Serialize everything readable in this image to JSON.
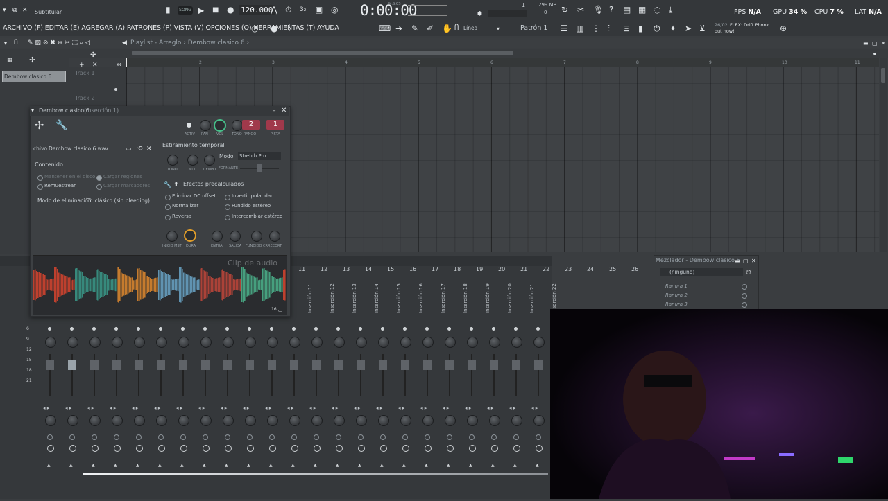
{
  "topbar": {
    "subtitle": "Subtitular",
    "song_label": "SONG",
    "tempo": "120.000",
    "time": "0:00:00",
    "time_unit": "M:S:CS",
    "memory": "299 MB",
    "cpu_count": "1",
    "voices": "0",
    "fps_label": "FPS",
    "fps_value": "N/A",
    "gpu_label": "GPU",
    "gpu_value": "34 %",
    "cpu_label": "CPU",
    "cpu_value": "7 %",
    "lat_label": "LAT",
    "lat_value": "N/A"
  },
  "menu": {
    "text": "ARCHIVO (F) EDITAR (E) AGREGAR (A) PATRONES (P) VISTA (V) OPCIONES (O) HERRAMIENTAS (T) AYUDA",
    "line_mode": "Línea",
    "pattern": "Patrón 1",
    "news_date": "26/02",
    "news_text": "FLEX: Drift Phonk",
    "news_sub": "out now!"
  },
  "playlist": {
    "title": "Playlist - Arreglo › Dembow clasico 6 ›",
    "ruler_marks": [
      "2",
      "3",
      "4",
      "5",
      "6",
      "7",
      "8",
      "9",
      "10",
      "11"
    ],
    "tracks": [
      "Track 1",
      "Track 2"
    ],
    "clip_label": "Dembow clasico 6"
  },
  "channel": {
    "title": "Dembow clasico 6",
    "subtitle": "(Inserción 1)",
    "knob_labels": [
      "ACTIV",
      "PAN",
      "VOL",
      "TONO",
      "RANGO",
      "PISTA"
    ],
    "slot_a": "2",
    "slot_b": "1",
    "file_label": "chivo",
    "file_name": "Dembow clasico 6.wav",
    "stretch_heading": "Estiramiento temporal",
    "stretch_knobs": [
      "TONO",
      "MUL",
      "TIEMPO"
    ],
    "mode_label": "Modo",
    "mode_value": "Stretch Pro",
    "formant_label": "FORMANTE",
    "content_heading": "Contenido",
    "opt_keep": "Mantener en el disco",
    "opt_regions": "Cargar regiones",
    "opt_resample": "Remuestrear",
    "opt_markers": "Cargar marcadores",
    "mode_elim": "Modo de eliminación",
    "mode_elim_value": "Tr. clásico (sin bleeding)",
    "precalc_heading": "Efectos precalculados",
    "fx": [
      "Eliminar DC offset",
      "Invertir polaridad",
      "Normalizar",
      "Fundido estéreo",
      "Reversa",
      "Intercambiar estéreo"
    ],
    "fx_knobs": [
      "INICIO MST",
      "DURA",
      "ENTRA",
      "SALIDA",
      "FUNDIDO CR",
      "RECORT"
    ],
    "clip_audio": "Clip de audio",
    "wave_counter": "16"
  },
  "mixer": {
    "title": "Mezclador - Dembow clasico 6",
    "none": "(ninguno)",
    "slots": [
      "Ranura 1",
      "Ranura 2",
      "Ranura 3"
    ],
    "numbers": [
      "11",
      "12",
      "13",
      "14",
      "15",
      "16",
      "17",
      "18",
      "19",
      "20",
      "21",
      "22",
      "23",
      "24",
      "25",
      "26"
    ],
    "insert_labels": [
      "Inserción 11",
      "Inserción 12",
      "Inserción 13",
      "Inserción 14",
      "Inserción 15",
      "Inserción 16",
      "Inserción 17",
      "Inserción 18",
      "Inserción 19",
      "Inserción 20",
      "Inserción 21",
      "Inserción 22",
      "Inserción 23",
      "Inserción 24",
      "Inserción 25",
      "Inserción 26"
    ],
    "db_marks": [
      "6",
      "9",
      "12",
      "15",
      "18",
      "21"
    ]
  },
  "colors": {
    "accent_green": "#46c08a",
    "accent_orange": "#e09d2a",
    "slot_red": "#a0394b",
    "background": "#3a3d40"
  }
}
